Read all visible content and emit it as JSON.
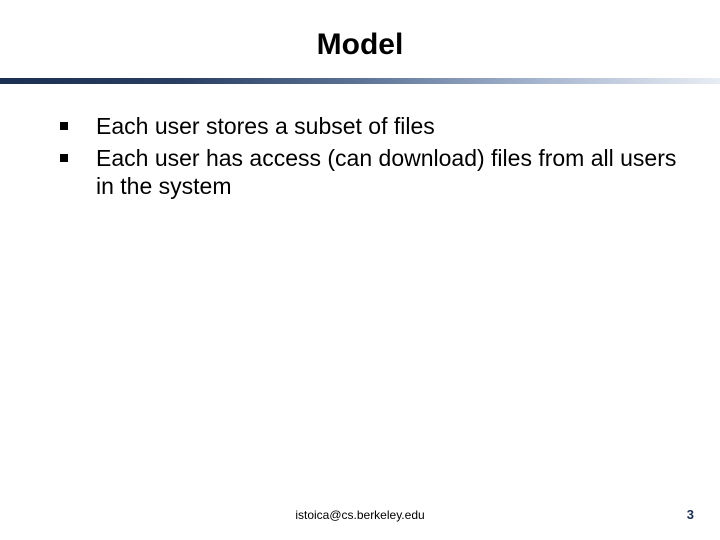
{
  "slide": {
    "title": "Model",
    "bullets": [
      "Each user stores a subset of files",
      "Each user has access (can download) files from all users in the system"
    ],
    "footer_email": "istoica@cs.berkeley.edu",
    "page_number": "3"
  }
}
